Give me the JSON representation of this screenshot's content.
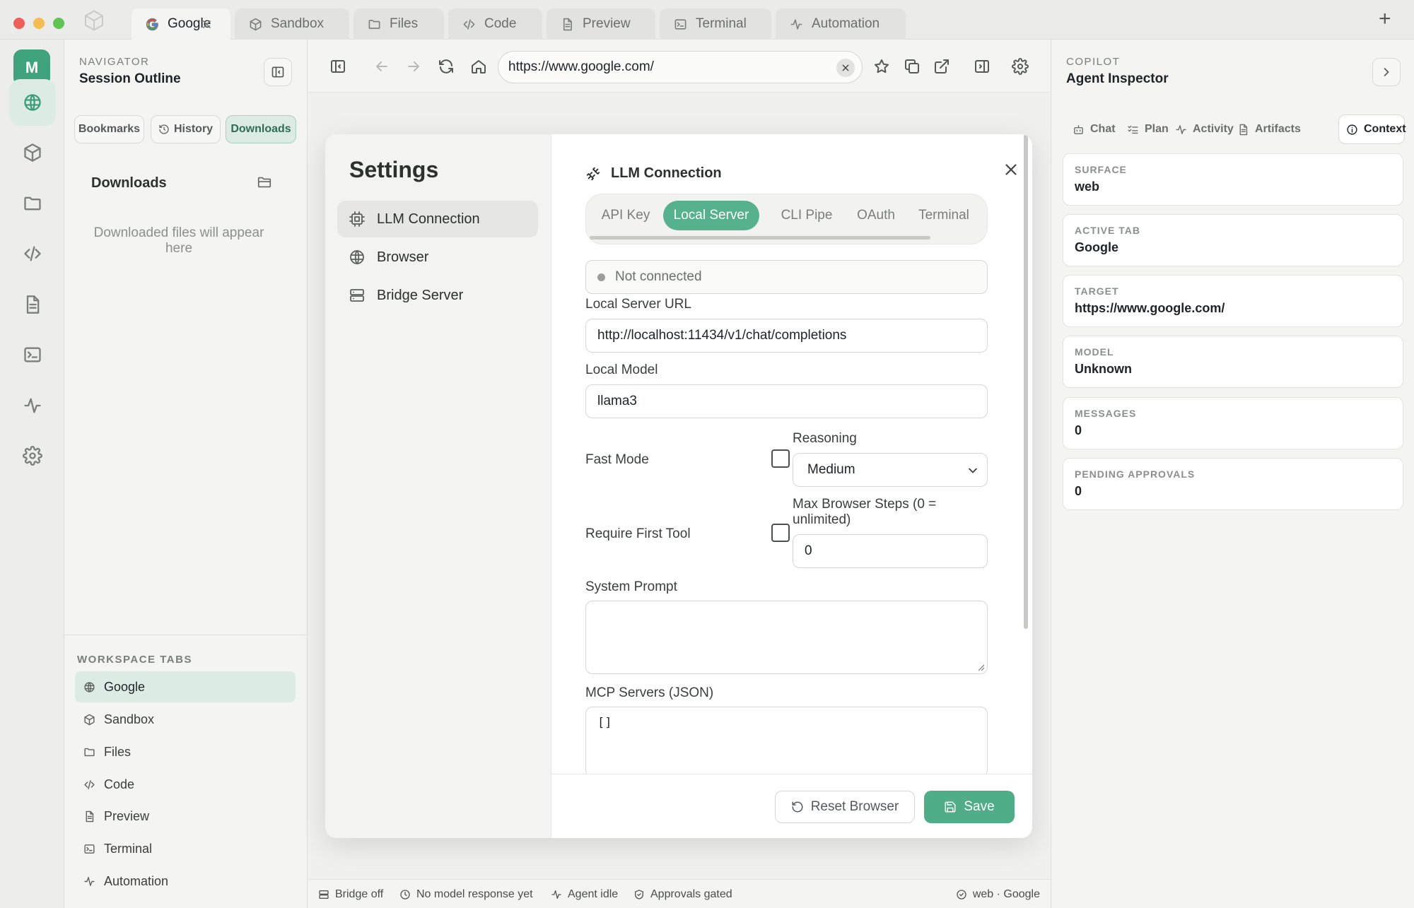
{
  "window": {
    "tabs": [
      {
        "label": "Google",
        "icon": "google-icon"
      },
      {
        "label": "Sandbox",
        "icon": "cube-icon"
      },
      {
        "label": "Files",
        "icon": "folder-icon"
      },
      {
        "label": "Code",
        "icon": "code-icon"
      },
      {
        "label": "Preview",
        "icon": "document-icon"
      },
      {
        "label": "Terminal",
        "icon": "terminal-icon"
      },
      {
        "label": "Automation",
        "icon": "activity-icon"
      }
    ],
    "new_tab_glyph": "+"
  },
  "rail": {
    "avatar_initial": "M",
    "items": [
      "globe-icon",
      "cube-icon",
      "folder-icon",
      "code-icon",
      "document-icon",
      "terminal-icon",
      "activity-icon",
      "gear-icon"
    ],
    "accent": "#3f9e7a"
  },
  "navigator": {
    "kicker": "NAVIGATOR",
    "title": "Session Outline",
    "pills": [
      "Bookmarks",
      "History",
      "Downloads"
    ],
    "downloads_title": "Downloads",
    "empty_text": "Downloaded files will appear here",
    "workspace_heading": "WORKSPACE TABS",
    "workspace_tabs": [
      "Google",
      "Sandbox",
      "Files",
      "Code",
      "Preview",
      "Terminal",
      "Automation"
    ]
  },
  "browser": {
    "url": "https://www.google.com/"
  },
  "settings": {
    "title": "Settings",
    "nav": [
      "LLM Connection",
      "Browser",
      "Bridge Server"
    ],
    "section_title": "LLM Connection",
    "modes": [
      "API Key",
      "Local Server",
      "CLI Pipe",
      "OAuth",
      "Terminal"
    ],
    "active_mode": "Local Server",
    "status": "Not connected",
    "url_label": "Local Server URL",
    "url_value": "http://localhost:11434/v1/chat/completions",
    "model_label": "Local Model",
    "model_value": "llama3",
    "fast_mode_label": "Fast Mode",
    "fast_mode_checked": false,
    "reasoning_label": "Reasoning",
    "reasoning_value": "Medium",
    "require_first_tool_label": "Require First Tool",
    "require_first_tool_checked": false,
    "max_steps_label": "Max Browser Steps (0 = unlimited)",
    "max_steps_value": "0",
    "system_prompt_label": "System Prompt",
    "system_prompt_value": "",
    "mcp_label": "MCP Servers (JSON)",
    "mcp_value": "[]",
    "reset_label": "Reset Browser",
    "save_label": "Save",
    "accent": "#55b28c"
  },
  "copilot": {
    "kicker": "COPILOT",
    "title": "Agent Inspector",
    "tabs": [
      "Chat",
      "Plan",
      "Activity",
      "Artifacts",
      "Context"
    ],
    "active_tab": "Context",
    "cards": [
      {
        "key": "SURFACE",
        "value": "web"
      },
      {
        "key": "ACTIVE TAB",
        "value": "Google"
      },
      {
        "key": "TARGET",
        "value": "https://www.google.com/"
      },
      {
        "key": "MODEL",
        "value": "Unknown"
      },
      {
        "key": "MESSAGES",
        "value": "0"
      },
      {
        "key": "PENDING APPROVALS",
        "value": "0"
      }
    ]
  },
  "statusbar": {
    "bridge": "Bridge off",
    "model": "No model response yet",
    "agent": "Agent idle",
    "approvals": "Approvals gated",
    "surface": "web · Google"
  }
}
